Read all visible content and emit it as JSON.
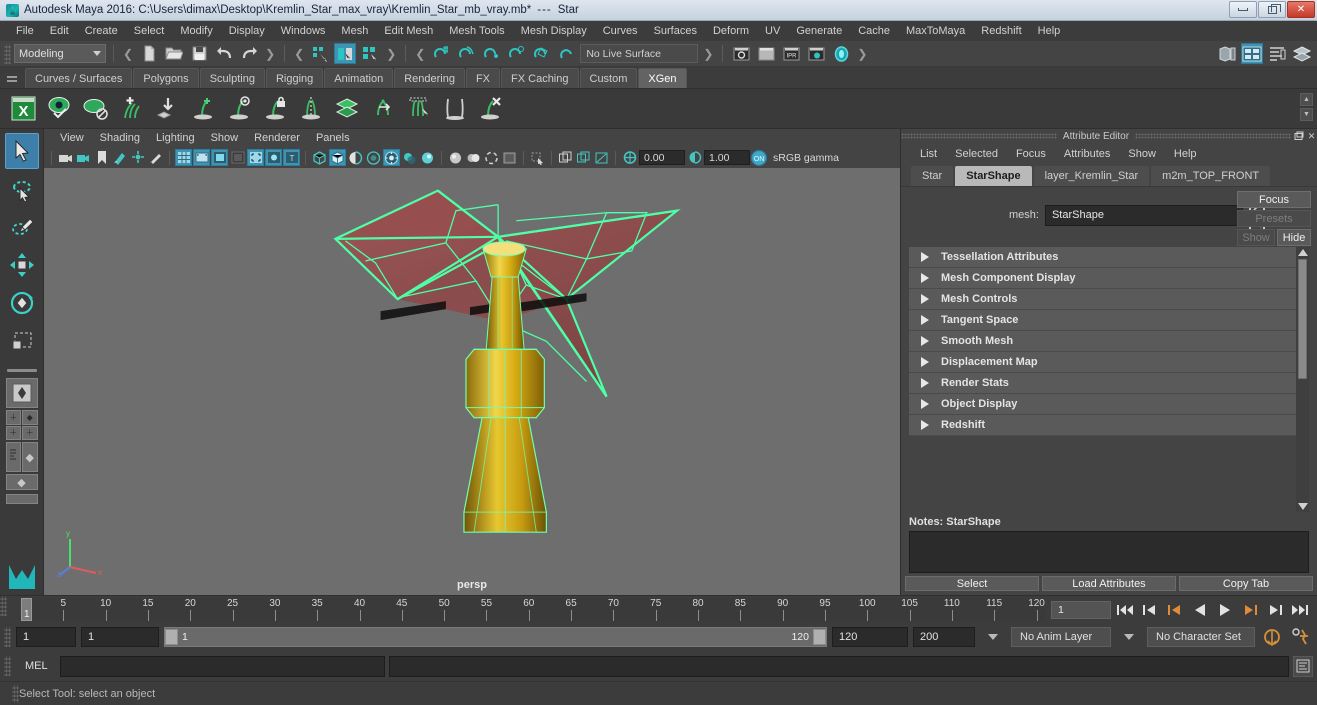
{
  "window": {
    "title": "Autodesk Maya 2016: C:\\Users\\dimax\\Desktop\\Kremlin_Star_max_vray\\Kremlin_Star_mb_vray.mb*",
    "separator": "---",
    "scene_name": "Star",
    "minimize": "minimize-button",
    "maximize": "restore-button",
    "close": "close-button",
    "app_icon": "maya-logo-icon"
  },
  "menubar": {
    "items": [
      {
        "label": "File"
      },
      {
        "label": "Edit"
      },
      {
        "label": "Create"
      },
      {
        "label": "Select"
      },
      {
        "label": "Modify"
      },
      {
        "label": "Display"
      },
      {
        "label": "Windows"
      },
      {
        "label": "Mesh"
      },
      {
        "label": "Edit Mesh"
      },
      {
        "label": "Mesh Tools"
      },
      {
        "label": "Mesh Display"
      },
      {
        "label": "Curves"
      },
      {
        "label": "Surfaces"
      },
      {
        "label": "Deform"
      },
      {
        "label": "UV"
      },
      {
        "label": "Generate"
      },
      {
        "label": "Cache"
      },
      {
        "label": "MaxToMaya"
      },
      {
        "label": "Redshift"
      },
      {
        "label": "Help"
      }
    ]
  },
  "statusline": {
    "menuset": "Modeling",
    "live_surface": "No Live Surface",
    "icons": [
      "new-scene-icon",
      "open-scene-icon",
      "save-scene-icon",
      "undo-icon",
      "redo-icon",
      "select-by-hierarchy-icon",
      "select-by-object-icon",
      "select-by-component-icon",
      "snap-to-grid-icon",
      "snap-to-curve-icon",
      "snap-to-point-icon",
      "snap-to-projected-center-icon",
      "snap-to-view-plane-icon",
      "make-live-icon",
      "render-current-frame-icon",
      "render-sequence-icon",
      "ipr-render-icon",
      "render-settings-icon",
      "hypershade-icon",
      "show-hide-editors-icon",
      "attribute-editor-toggle-icon",
      "channel-box-toggle-icon",
      "layer-editor-toggle-icon"
    ]
  },
  "shelf": {
    "tabs": [
      {
        "label": "Curves / Surfaces",
        "active": false
      },
      {
        "label": "Polygons",
        "active": false
      },
      {
        "label": "Sculpting",
        "active": false
      },
      {
        "label": "Rigging",
        "active": false
      },
      {
        "label": "Animation",
        "active": false
      },
      {
        "label": "Rendering",
        "active": false
      },
      {
        "label": "FX",
        "active": false
      },
      {
        "label": "FX Caching",
        "active": false
      },
      {
        "label": "Custom",
        "active": false
      },
      {
        "label": "XGen",
        "active": true
      }
    ],
    "icons": [
      "xgen-editor-icon",
      "xgen-preview-icon",
      "xgen-disable-preview-icon",
      "xgen-add-description-icon",
      "xgen-import-collection-icon",
      "xgen-grow-guide-icon",
      "xgen-preview-guide-icon",
      "xgen-lock-guide-icon",
      "xgen-mirror-guide-icon",
      "xgen-layers-icon",
      "xgen-convert-to-polygons-icon",
      "xgen-select-guides-icon",
      "xgen-clumping-icon",
      "xgen-delete-guide-icon"
    ]
  },
  "toolbox": {
    "tools": [
      {
        "name": "select-tool",
        "active": true
      },
      {
        "name": "lasso-select-tool",
        "active": false
      },
      {
        "name": "paint-select-tool",
        "active": false
      },
      {
        "name": "move-tool",
        "active": false
      },
      {
        "name": "rotate-tool",
        "active": false
      },
      {
        "name": "scale-tool",
        "active": false
      }
    ],
    "layouts": [
      "single-perspective-layout",
      "four-view-layout",
      "two-pane-layout",
      "outliner-persp-layout",
      "persp-graph-layout"
    ]
  },
  "viewport": {
    "menu": [
      {
        "label": "View"
      },
      {
        "label": "Shading"
      },
      {
        "label": "Lighting"
      },
      {
        "label": "Show"
      },
      {
        "label": "Renderer"
      },
      {
        "label": "Panels"
      }
    ],
    "toolbar": {
      "exposure_value": "0.00",
      "gamma_value": "1.00",
      "color_management": "sRGB gamma",
      "icons": [
        "select-camera-icon",
        "camera-attributes-icon",
        "bookmark-icon",
        "image-plane-icon",
        "two-d-pan-zoom-icon",
        "grease-pencil-icon",
        "grid-toggle-icon",
        "film-gate-icon",
        "resolution-gate-icon",
        "gate-mask-icon",
        "film-origin-icon",
        "safe-action-icon",
        "safe-title-icon",
        "wireframe-shading-icon",
        "smooth-shade-all-icon",
        "shade-wireframe-icon",
        "textured-icon",
        "use-all-lights-icon",
        "shadows-icon",
        "ambient-occlusion-icon",
        "motion-blur-icon",
        "multisample-icon",
        "xray-icon",
        "xray-joints-icon",
        "xray-active-components-icon",
        "isolate-select-icon",
        "panel-display-icon",
        "grid-display-icon",
        "film-back-icon",
        "exposure-icon",
        "gamma-icon",
        "color-management-icon"
      ]
    },
    "camera_label": "persp",
    "axis_gizmo": "axis-orientation-gizmo",
    "model": {
      "name": "Kremlin Star",
      "star_color": "#4dffa6",
      "body_color": "#d4b016",
      "face_color": "#8c4a4a"
    }
  },
  "attribute_editor": {
    "panel_title": "Attribute Editor",
    "menu": [
      {
        "label": "List"
      },
      {
        "label": "Selected"
      },
      {
        "label": "Focus"
      },
      {
        "label": "Attributes"
      },
      {
        "label": "Show"
      },
      {
        "label": "Help"
      }
    ],
    "tabs": [
      {
        "label": "Star",
        "active": false
      },
      {
        "label": "StarShape",
        "active": true
      },
      {
        "label": "layer_Kremlin_Star",
        "active": false
      },
      {
        "label": "m2m_TOP_FRONT",
        "active": false
      }
    ],
    "mesh_label": "mesh:",
    "mesh_value": "StarShape",
    "focus_button": "Focus",
    "presets_button": "Presets",
    "show_button": "Show",
    "hide_button": "Hide",
    "sections": [
      {
        "label": "Tessellation Attributes"
      },
      {
        "label": "Mesh Component Display"
      },
      {
        "label": "Mesh Controls"
      },
      {
        "label": "Tangent Space"
      },
      {
        "label": "Smooth Mesh"
      },
      {
        "label": "Displacement Map"
      },
      {
        "label": "Render Stats"
      },
      {
        "label": "Object Display"
      },
      {
        "label": "Redshift"
      }
    ],
    "notes_label": "Notes:",
    "notes_target": "StarShape",
    "notes_value": "",
    "footer_buttons": [
      {
        "label": "Select"
      },
      {
        "label": "Load Attributes"
      },
      {
        "label": "Copy Tab"
      }
    ],
    "window_buttons": [
      "undock-icon",
      "close-icon"
    ]
  },
  "timeslider": {
    "ticks": [
      5,
      10,
      15,
      20,
      25,
      30,
      35,
      40,
      45,
      50,
      55,
      60,
      65,
      70,
      75,
      80,
      85,
      90,
      95,
      100,
      105,
      110,
      115,
      120
    ],
    "current_frame": "1",
    "current_frame_field": "1",
    "playback_buttons": [
      "go-to-start-icon",
      "step-back-keyframe-icon",
      "step-back-frame-icon",
      "play-backwards-icon",
      "play-forwards-icon",
      "step-forward-frame-icon",
      "step-forward-keyframe-icon",
      "go-to-end-icon"
    ]
  },
  "rangeslider": {
    "anim_start": "1",
    "range_start": "1",
    "bar_start": "1",
    "bar_end": "120",
    "range_end": "120",
    "anim_end": "200",
    "anim_layer": "No Anim Layer",
    "character_set": "No Character Set",
    "auto_key_icon": "auto-keyframe-icon",
    "animation_prefs_icon": "animation-preferences-icon"
  },
  "commandline": {
    "language_label": "MEL",
    "input_value": "",
    "output_value": "",
    "script_editor_icon": "script-editor-icon"
  },
  "helpline": {
    "message": "Select Tool: select an object"
  },
  "colors": {
    "accent_blue": "#3d94b5",
    "panel_bg": "#444444",
    "viewport_bg": "#6e6e6e",
    "selection_green": "#4dffa6",
    "title_gradient_start": "#dfe6ee"
  }
}
